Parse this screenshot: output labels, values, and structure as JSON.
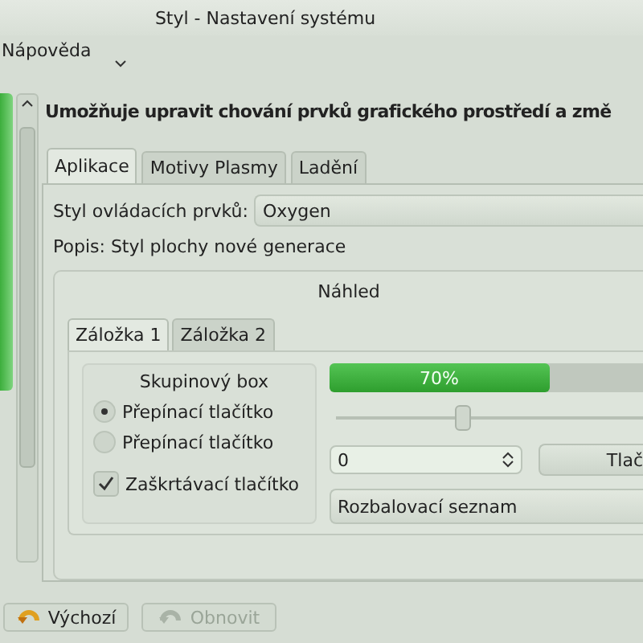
{
  "window": {
    "title": "Styl - Nastavení systému"
  },
  "menu": {
    "items": [
      "Nápověda"
    ]
  },
  "header": "Umožňuje upravit chování prvků grafického prostředí a změ",
  "tabs": [
    {
      "label": "Aplikace",
      "selected": true
    },
    {
      "label": "Motivy Plasmy",
      "selected": false
    },
    {
      "label": "Ladění",
      "selected": false
    }
  ],
  "style_field": {
    "label": "Styl ovládacích prvků:",
    "value": "Oxygen"
  },
  "description": "Popis: Styl plochy nové generace",
  "preview": {
    "title": "Náhled",
    "tabs": [
      {
        "label": "Záložka 1",
        "selected": true
      },
      {
        "label": "Záložka 2",
        "selected": false
      }
    ],
    "group": {
      "title": "Skupinový box",
      "radios": [
        {
          "label": "Přepínací tlačítko",
          "selected": true
        },
        {
          "label": "Přepínací tlačítko",
          "selected": false
        }
      ],
      "checkbox": {
        "label": "Zaškrtávací tlačítko",
        "checked": true
      }
    },
    "progress": {
      "level": 0.7,
      "reading": "70%"
    },
    "slider": {
      "level": 0.42
    },
    "spin": {
      "value": "0"
    },
    "button": "Tlač",
    "combo": "Rozbalovací seznam"
  },
  "buttons": [
    {
      "label": "Výchozí",
      "disabled": false
    },
    {
      "label": "Obnovit",
      "disabled": true
    }
  ]
}
